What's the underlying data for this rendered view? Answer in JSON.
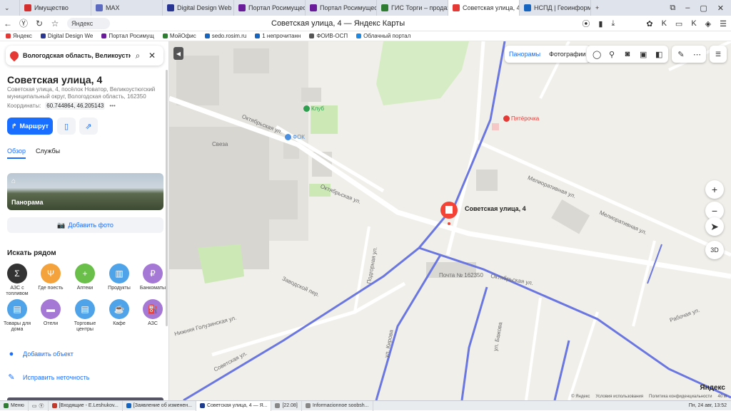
{
  "browser": {
    "tabs": [
      {
        "label": "Имущество",
        "color": "#d32f2f",
        "active": false
      },
      {
        "label": "MAX",
        "color": "#5c6bc0",
        "active": false
      },
      {
        "label": "Digital Design Web Cl",
        "color": "#283593",
        "active": false
      },
      {
        "label": "Портал Росимущесте",
        "color": "#6a1b9a",
        "active": false
      },
      {
        "label": "Портал Росимущесте",
        "color": "#6a1b9a",
        "active": false
      },
      {
        "label": "ГИС Торги – продажа",
        "color": "#2e7d32",
        "active": false
      },
      {
        "label": "Советская улица, 4",
        "color": "#e53935",
        "active": true
      },
      {
        "label": "НСПД | Геоинформа",
        "color": "#1565c0",
        "active": false
      }
    ],
    "address_chip": "Яндекс",
    "page_title": "Советская улица, 4 — Яндекс Карты",
    "bookmarks": [
      {
        "label": "Яндекс",
        "color": "#e53935"
      },
      {
        "label": "Digital Design We",
        "color": "#283593"
      },
      {
        "label": "Портал Росимущ",
        "color": "#6a1b9a"
      },
      {
        "label": "МойОфис",
        "color": "#2e7d32"
      },
      {
        "label": "sedo.rosim.ru",
        "color": "#1565c0"
      },
      {
        "label": "1 непрочитанн",
        "color": "#1565c0"
      },
      {
        "label": "ФОИВ-ОСП",
        "color": "#555555"
      },
      {
        "label": "Облачный портал",
        "color": "#1e88e5"
      }
    ]
  },
  "sidebar": {
    "search_query": "Вологодская область, Великоустюгский",
    "place_title": "Советская улица, 4",
    "place_address": "Советская улица, 4, посёлок Новатор, Великоустюгский муниципальный округ, Вологодская область, 162350",
    "coords_label": "Координаты:",
    "coords_value": "60.744864, 46.205143",
    "route_label": "Маршрут",
    "tabs": [
      "Обзор",
      "Службы"
    ],
    "panorama_label": "Панорама",
    "add_photo_label": "Добавить фото",
    "nearby_heading": "Искать рядом",
    "categories": [
      {
        "label": "АЗС с топливом",
        "color": "#333333",
        "icon": "Σ"
      },
      {
        "label": "Где поесть",
        "color": "#f4a23c",
        "icon": "🍴"
      },
      {
        "label": "Аптеки",
        "color": "#6abf4b",
        "icon": "+"
      },
      {
        "label": "Продукты",
        "color": "#4fa3e8",
        "icon": "🛒"
      },
      {
        "label": "Банкоматы",
        "color": "#a678d6",
        "icon": "₽"
      },
      {
        "label": "Товары для дома",
        "color": "#4fa3e8",
        "icon": "🛍"
      },
      {
        "label": "Отели",
        "color": "#a678d6",
        "icon": "🛏"
      },
      {
        "label": "Торговые центры",
        "color": "#4fa3e8",
        "icon": "🛍"
      },
      {
        "label": "Кафе",
        "color": "#4fa3e8",
        "icon": "☕"
      },
      {
        "label": "АЗС",
        "color": "#a678d6",
        "icon": "⛽"
      }
    ],
    "actions": [
      "Добавить объект",
      "Исправить неточность"
    ]
  },
  "map": {
    "top_buttons": [
      "Панорамы",
      "Фотографии"
    ],
    "place_label": "Советская улица, 4",
    "labels": [
      {
        "text": "Октябрьская ул.",
        "cls": "oct1"
      },
      {
        "text": "Октябрьская ул.",
        "cls": "oct2"
      },
      {
        "text": "Октябрьская ул.",
        "cls": "oct3"
      },
      {
        "text": "Мелиоративная ул.",
        "cls": "mel1"
      },
      {
        "text": "Мелиоративная ул.",
        "cls": "mel2"
      },
      {
        "text": "Советская ул.",
        "cls": "sov1"
      },
      {
        "text": "Заводской пер.",
        "cls": "zav"
      },
      {
        "text": "Нижняя Голузинская ул.",
        "cls": "golu"
      },
      {
        "text": "Подгорная ул.",
        "cls": "podg"
      },
      {
        "text": "ул. Кирова",
        "cls": "kir"
      },
      {
        "text": "ул. Бажова",
        "cls": "baj"
      },
      {
        "text": "Рабочая ул.",
        "cls": "rab"
      },
      {
        "text": "Свеза",
        "cls": "svez"
      },
      {
        "text": "Почта № 162350",
        "cls": "pocht"
      }
    ],
    "pois": [
      {
        "text": "Клуб",
        "color": "#2e9e4f"
      },
      {
        "text": "ФОК",
        "color": "#4a8fe0"
      },
      {
        "text": "Пятёрочка",
        "color": "#e53935"
      }
    ],
    "zoom_plus": "+",
    "zoom_minus": "−",
    "compass": "➤",
    "three_d": "3D",
    "brand": "Яндекс",
    "footer_links": [
      "© Яндекс",
      "Условия использования",
      "Политика конфиденциальности"
    ],
    "scale": "40 м"
  },
  "taskbar": {
    "items": [
      {
        "label": "Меню",
        "color": "#2e7d32",
        "active": false
      },
      {
        "label": "[Входящие - E.Leshukov...",
        "color": "#c0392b",
        "active": false
      },
      {
        "label": "[Заявление об изменен...",
        "color": "#1565c0",
        "active": false
      },
      {
        "label": "Советская улица, 4 — Я...",
        "color": "#1e3a8a",
        "active": true
      },
      {
        "label": "[22.08]",
        "color": "#888888",
        "active": false
      },
      {
        "label": "Informacionnoe soobsh...",
        "color": "#888888",
        "active": false
      }
    ],
    "clock": "Пн, 24 авг, 13:52"
  }
}
